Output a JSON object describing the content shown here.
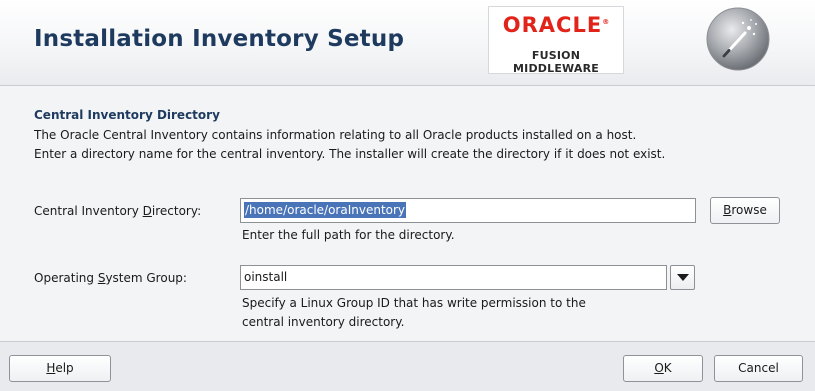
{
  "header": {
    "title": "Installation Inventory Setup",
    "logo_brand": "ORACLE",
    "logo_product": "FUSION MIDDLEWARE"
  },
  "main": {
    "section_title": "Central Inventory Directory",
    "description_line1": "The Oracle Central Inventory contains information relating to all Oracle products installed on a host.",
    "description_line2": "Enter a directory name for the central inventory. The installer will create the directory if it does not exist.",
    "inventory_dir": {
      "label_pre": "Central Inventory ",
      "label_mnemonic": "D",
      "label_post": "irectory:",
      "value": "/home/oracle/oraInventory",
      "hint": "Enter the full path for the directory.",
      "browse_mnemonic": "B",
      "browse_rest": "rowse"
    },
    "os_group": {
      "label_pre": "Operating ",
      "label_mnemonic": "S",
      "label_post": "ystem Group:",
      "value": "oinstall",
      "hint_line1": "Specify a Linux Group ID that has write permission to the",
      "hint_line2": "central inventory directory."
    }
  },
  "footer": {
    "help_mnemonic": "H",
    "help_rest": "elp",
    "ok_mnemonic": "O",
    "ok_rest": "K",
    "cancel_label": "Cancel"
  }
}
